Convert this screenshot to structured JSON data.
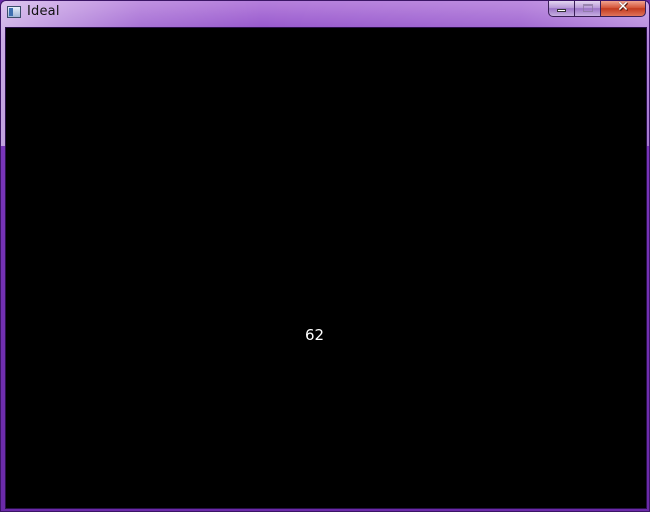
{
  "window": {
    "title": "Ideal",
    "icon": "app-window-icon",
    "controls": {
      "minimize": "minimize-icon",
      "maximize": "maximize-icon",
      "close": "close-icon"
    },
    "colors": {
      "frame": "#7a36bb",
      "client_background": "#000000",
      "close_button": "#c23a1f"
    }
  },
  "client": {
    "value_text": "62",
    "text_color": "#ffffff"
  }
}
